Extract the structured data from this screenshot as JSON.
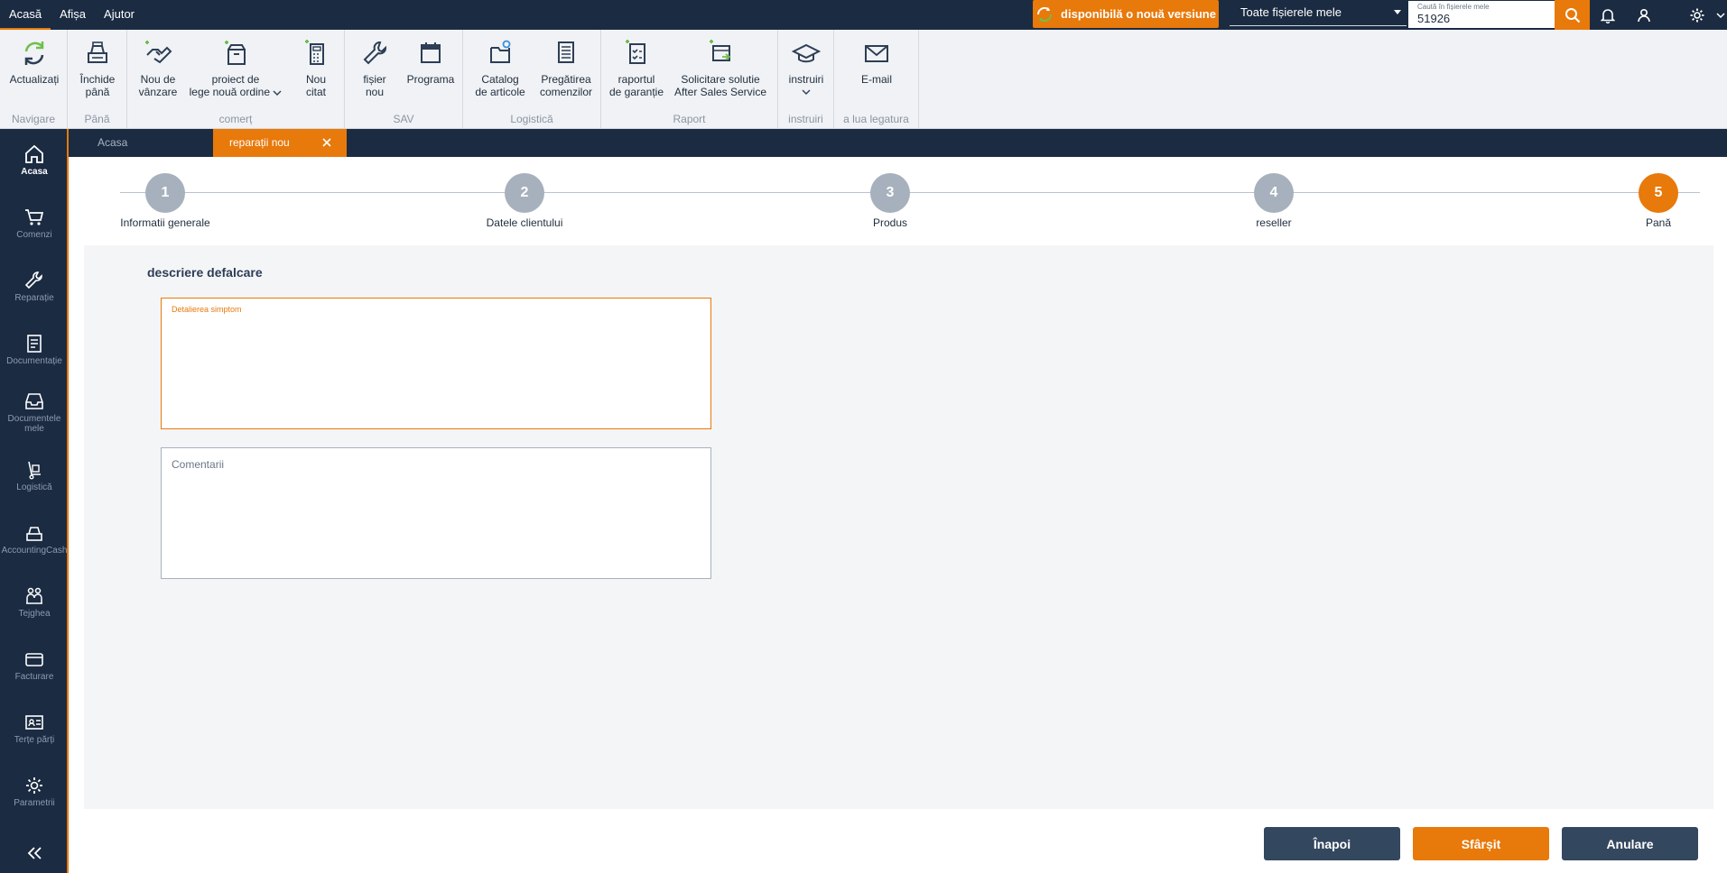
{
  "menu": {
    "items": [
      "Acasă",
      "Afișa",
      "Ajutor"
    ]
  },
  "topbar": {
    "update_label": "disponibilă o nouă versiune",
    "scope_value": "Toate fișierele mele",
    "search_label": "Caută în fișierele mele",
    "search_value": "51926"
  },
  "ribbon": {
    "groups": {
      "navigare": "Navigare",
      "pana": "Până",
      "comert": "comerț",
      "sav": "SAV",
      "logistica": "Logistică",
      "raport": "Raport",
      "instruiri": "instruiri",
      "contact": "a lua legatura"
    },
    "buttons": {
      "actualizati": "Actualizați",
      "inchide1": "Închide",
      "inchide2": "până",
      "nou_vanzare1": "Nou de",
      "nou_vanzare2": "vânzare",
      "proiect1": "proiect de",
      "proiect2": "lege nouă ordine",
      "nou_citat1": "Nou",
      "nou_citat2": "citat",
      "fisier1": "fișier",
      "fisier2": "nou",
      "programa": "Programa",
      "catalog1": "Catalog",
      "catalog2": "de articole",
      "pregatirea1": "Pregătirea",
      "pregatirea2": "comenzilor",
      "raportul1": "raportul",
      "raportul2": "de garanție",
      "solicitare1": "Solicitare solutie",
      "solicitare2": "After Sales Service",
      "instruiri": "instruiri",
      "email": "E-mail"
    }
  },
  "leftnav": {
    "acasa": "Acasa",
    "comenzi": "Comenzi",
    "reparatie": "Reparație",
    "documentatie": "Documentație",
    "documentele1": "Documentele",
    "documentele2": "mele",
    "logistica": "Logistică",
    "accounting": "AccountingCash",
    "tejghea": "Tejghea",
    "facturare": "Facturare",
    "terte": "Terțe părți",
    "parametrii": "Parametrii"
  },
  "tabs": {
    "home": "Acasa",
    "current": "reparații nou"
  },
  "stepper": {
    "steps": [
      {
        "num": "1",
        "label": "Informatii generale"
      },
      {
        "num": "2",
        "label": "Datele clientului"
      },
      {
        "num": "3",
        "label": "Produs"
      },
      {
        "num": "4",
        "label": "reseller"
      },
      {
        "num": "5",
        "label": "Pană"
      }
    ]
  },
  "form": {
    "section_title": "descriere defalcare",
    "symptom_label": "Detalierea simptom",
    "comments_placeholder": "Comentarii"
  },
  "actions": {
    "back": "Înapoi",
    "finish": "Sfârșit",
    "cancel": "Anulare"
  },
  "colors": {
    "accent": "#e8790b",
    "navy": "#1b2b42",
    "button_dark": "#33475f"
  }
}
